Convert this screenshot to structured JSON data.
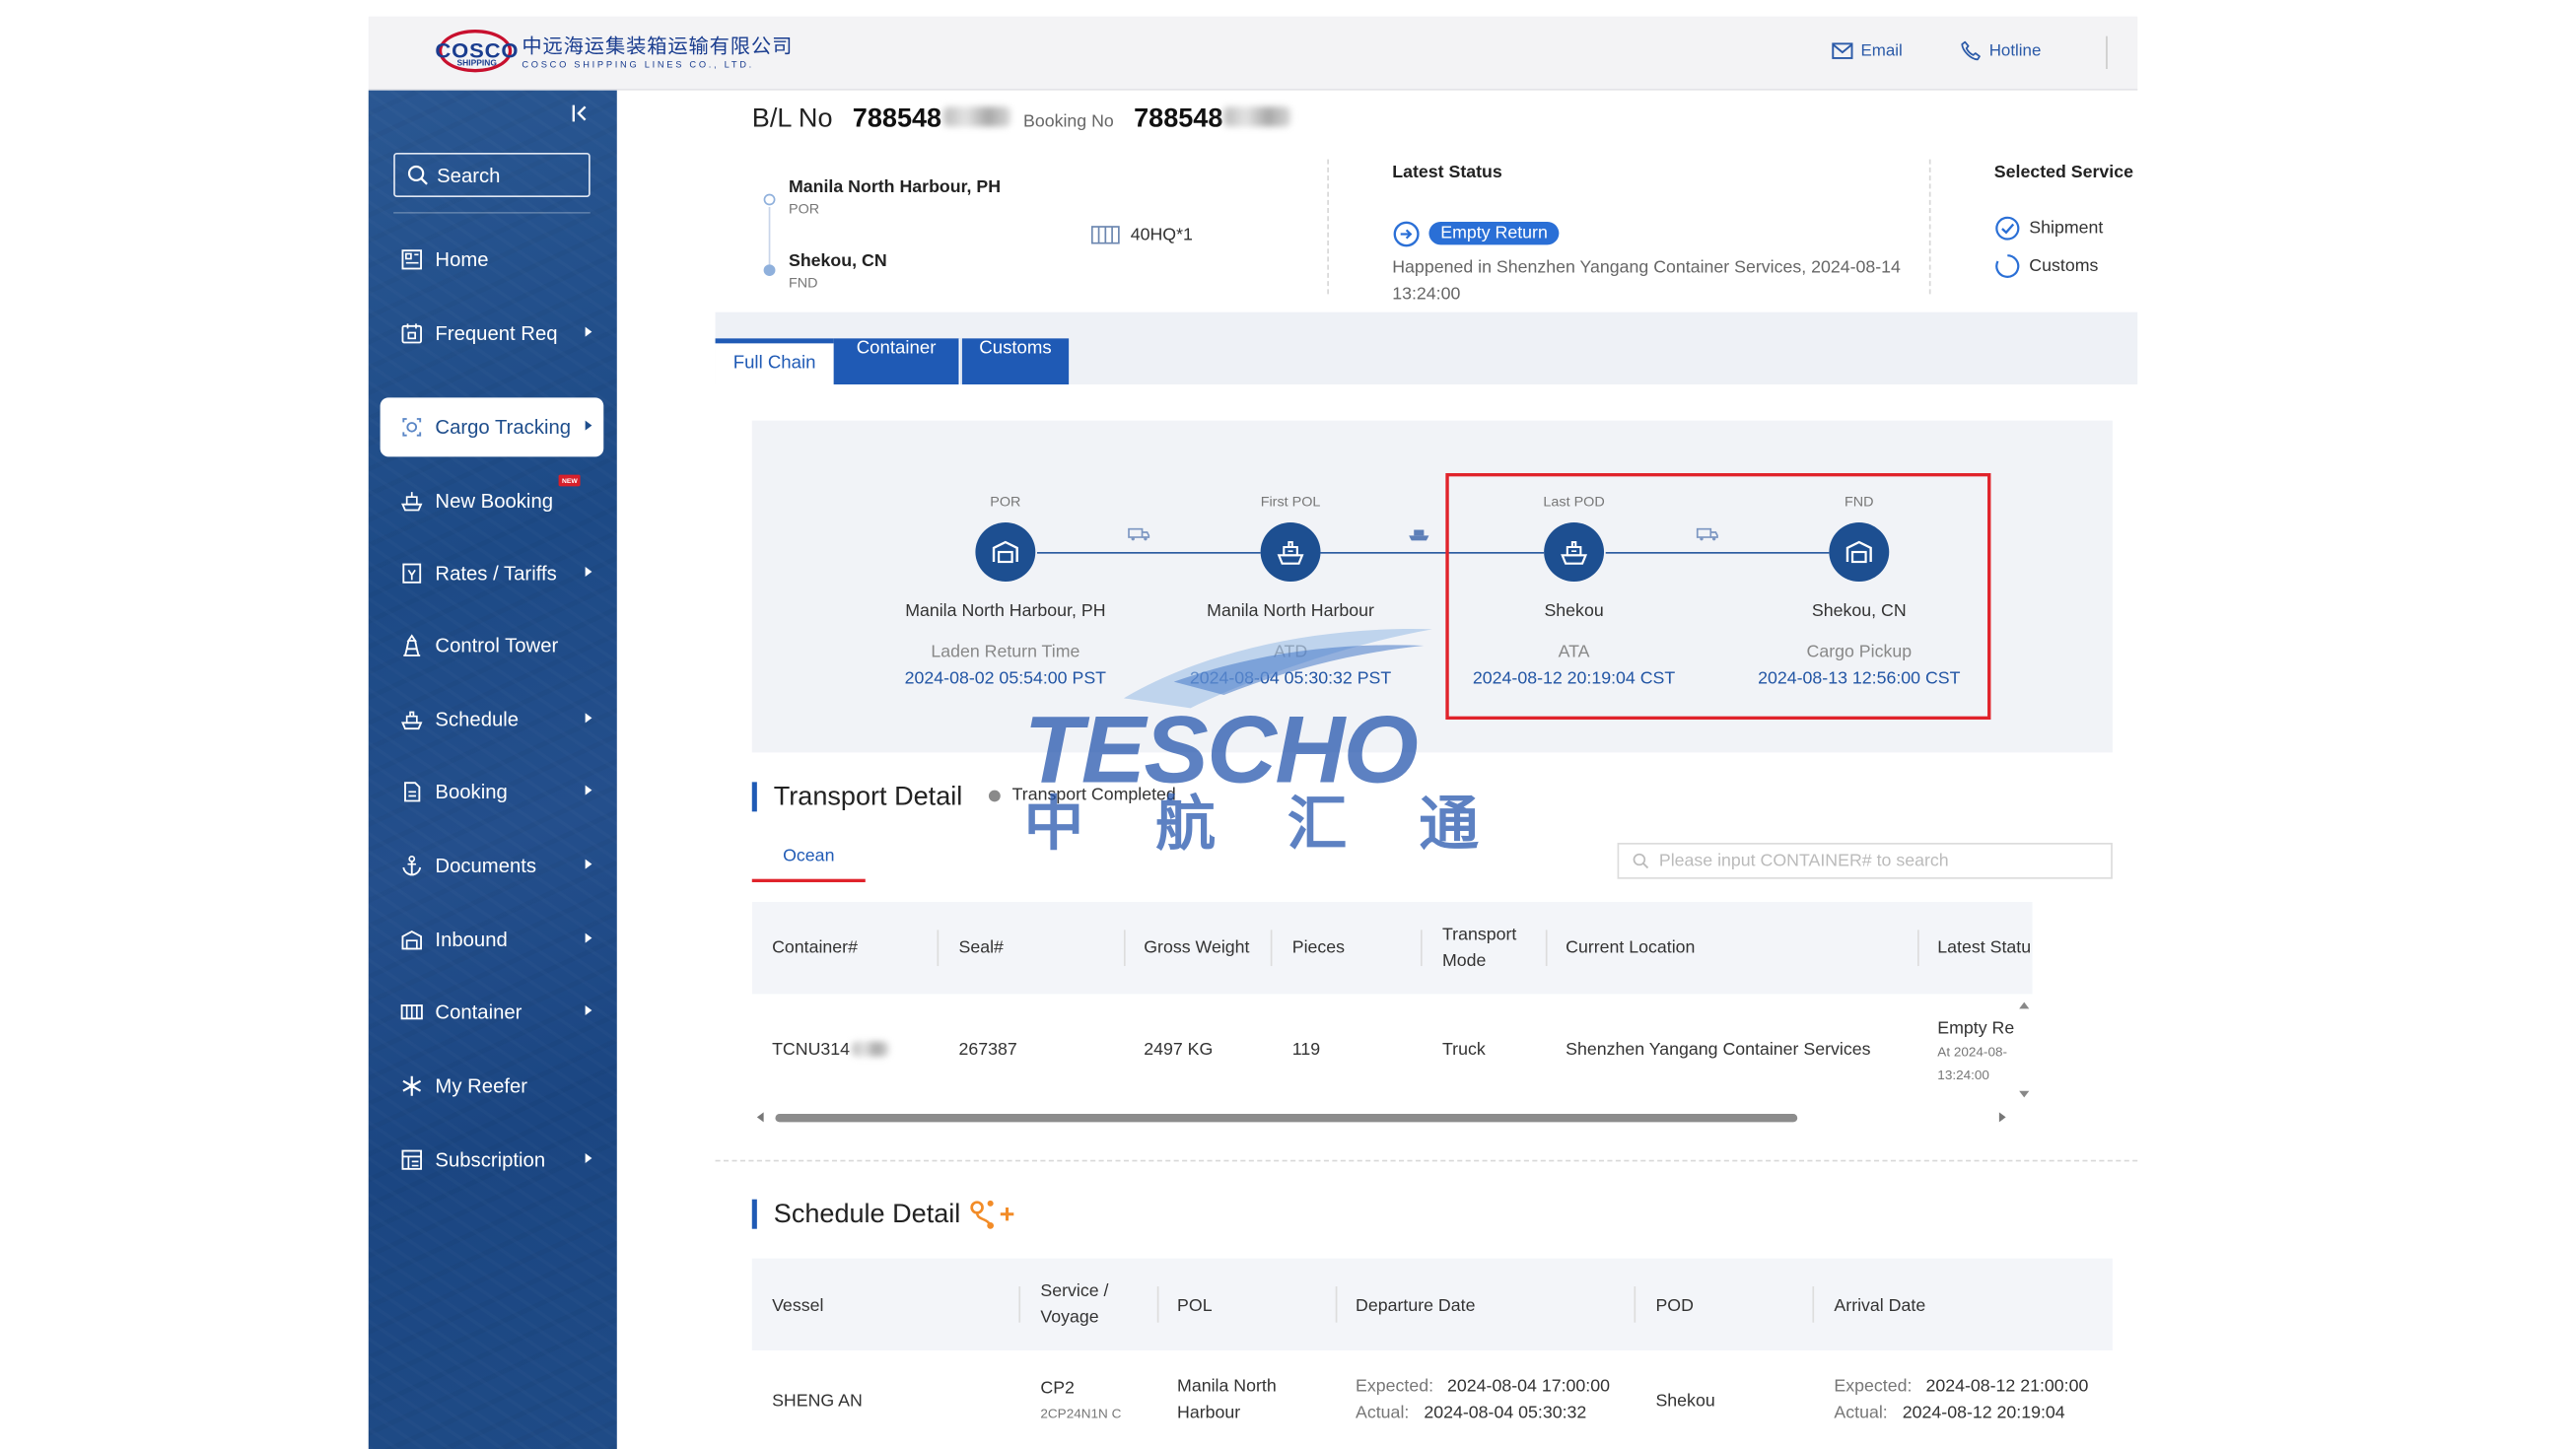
{
  "header": {
    "logo_wordmark": "COSCO",
    "logo_sub": "SHIPPING",
    "logo_cn": "中远海运集装箱运输有限公司",
    "logo_en": "COSCO SHIPPING LINES CO., LTD.",
    "email_label": "Email",
    "hotline_label": "Hotline"
  },
  "sidebar": {
    "search_label": "Search",
    "items": [
      {
        "label": "Home",
        "icon": "home-icon",
        "caret": false
      },
      {
        "label": "Frequent Req",
        "icon": "frequent-icon",
        "caret": true
      },
      {
        "label": "Cargo Tracking",
        "icon": "tracking-icon",
        "caret": true,
        "active": true
      },
      {
        "label": "New Booking",
        "icon": "booking-ship-icon",
        "caret": false,
        "badge": "NEW"
      },
      {
        "label": "Rates / Tariffs",
        "icon": "rates-icon",
        "caret": true
      },
      {
        "label": "Control Tower",
        "icon": "tower-icon",
        "caret": false
      },
      {
        "label": "Schedule",
        "icon": "schedule-ship-icon",
        "caret": true
      },
      {
        "label": "Booking",
        "icon": "booking-doc-icon",
        "caret": true
      },
      {
        "label": "Documents",
        "icon": "anchor-icon",
        "caret": true
      },
      {
        "label": "Inbound",
        "icon": "inbound-icon",
        "caret": true
      },
      {
        "label": "Container",
        "icon": "container-icon",
        "caret": true
      },
      {
        "label": "My Reefer",
        "icon": "snowflake-icon",
        "caret": false
      },
      {
        "label": "Subscription",
        "icon": "subscription-icon",
        "caret": true
      }
    ]
  },
  "summary": {
    "bl_label": "B/L No",
    "bl_number": "788548",
    "booking_label": "Booking No",
    "booking_number": "788548",
    "origin": "Manila North Harbour, PH",
    "origin_type": "POR",
    "destination": "Shekou, CN",
    "destination_type": "FND",
    "equipment": "40HQ*1",
    "latest_status_title": "Latest Status",
    "status_badge": "Empty Return",
    "status_line1": "Happened in Shenzhen Yangang Container Services, 2024-08-14",
    "status_line2": "13:24:00",
    "selected_service_title": "Selected Service",
    "services": [
      "Shipment",
      "Customs"
    ]
  },
  "tabs": [
    "Full Chain",
    "Container",
    "Customs"
  ],
  "chain": {
    "nodes": [
      {
        "type": "POR",
        "name": "Manila North Harbour, PH",
        "event": "Laden Return Time",
        "time": "2024-08-02 05:54:00 PST",
        "icon": "warehouse-icon"
      },
      {
        "type": "First POL",
        "name": "Manila North Harbour",
        "event": "ATD",
        "time": "2024-08-04 05:30:32 PST",
        "icon": "ship-icon"
      },
      {
        "type": "Last POD",
        "name": "Shekou",
        "event": "ATA",
        "time": "2024-08-12 20:19:04 CST",
        "icon": "ship-icon"
      },
      {
        "type": "FND",
        "name": "Shekou, CN",
        "event": "Cargo Pickup",
        "time": "2024-08-13 12:56:00 CST",
        "icon": "warehouse-icon"
      }
    ]
  },
  "watermark": {
    "en": "TESCHO",
    "cn": "中航汇通"
  },
  "transport": {
    "title": "Transport Detail",
    "status": "Transport Completed",
    "mode_tab": "Ocean",
    "search_placeholder": "Please input CONTAINER# to search",
    "columns": [
      "Container#",
      "Seal#",
      "Gross Weight",
      "Pieces",
      "Transport",
      "Mode",
      "Current Location",
      "Latest Statu"
    ],
    "rows": [
      {
        "container": "TCNU314",
        "seal": "267387",
        "weight": "2497 KG",
        "pieces": "119",
        "mode": "Truck",
        "location": "Shenzhen Yangang Container Services",
        "status": "Empty Re",
        "status_at": "At 2024-08-",
        "status_time": "13:24:00"
      }
    ]
  },
  "schedule": {
    "title": "Schedule Detail",
    "columns": [
      "Vessel",
      "Service /",
      "Voyage",
      "POL",
      "Departure Date",
      "POD",
      "Arrival Date"
    ],
    "rows": [
      {
        "vessel": "SHENG AN",
        "service": "CP2",
        "voyage": "2CP24N1N C",
        "pol_line1": "Manila North",
        "pol_line2": "Harbour",
        "dep_expected_label": "Expected:",
        "dep_expected": "2024-08-04 17:00:00",
        "dep_actual_label": "Actual:",
        "dep_actual": "2024-08-04 05:30:32",
        "pod": "Shekou",
        "arr_expected_label": "Expected:",
        "arr_expected": "2024-08-12 21:00:00",
        "arr_actual_label": "Actual:",
        "arr_actual": "2024-08-12 20:19:04"
      }
    ]
  },
  "colors": {
    "primary": "#1f5ab5",
    "sidebar": "#1f4b86",
    "node": "#1d4f91",
    "highlight": "#e0232b",
    "accent_orange": "#f28c28"
  }
}
